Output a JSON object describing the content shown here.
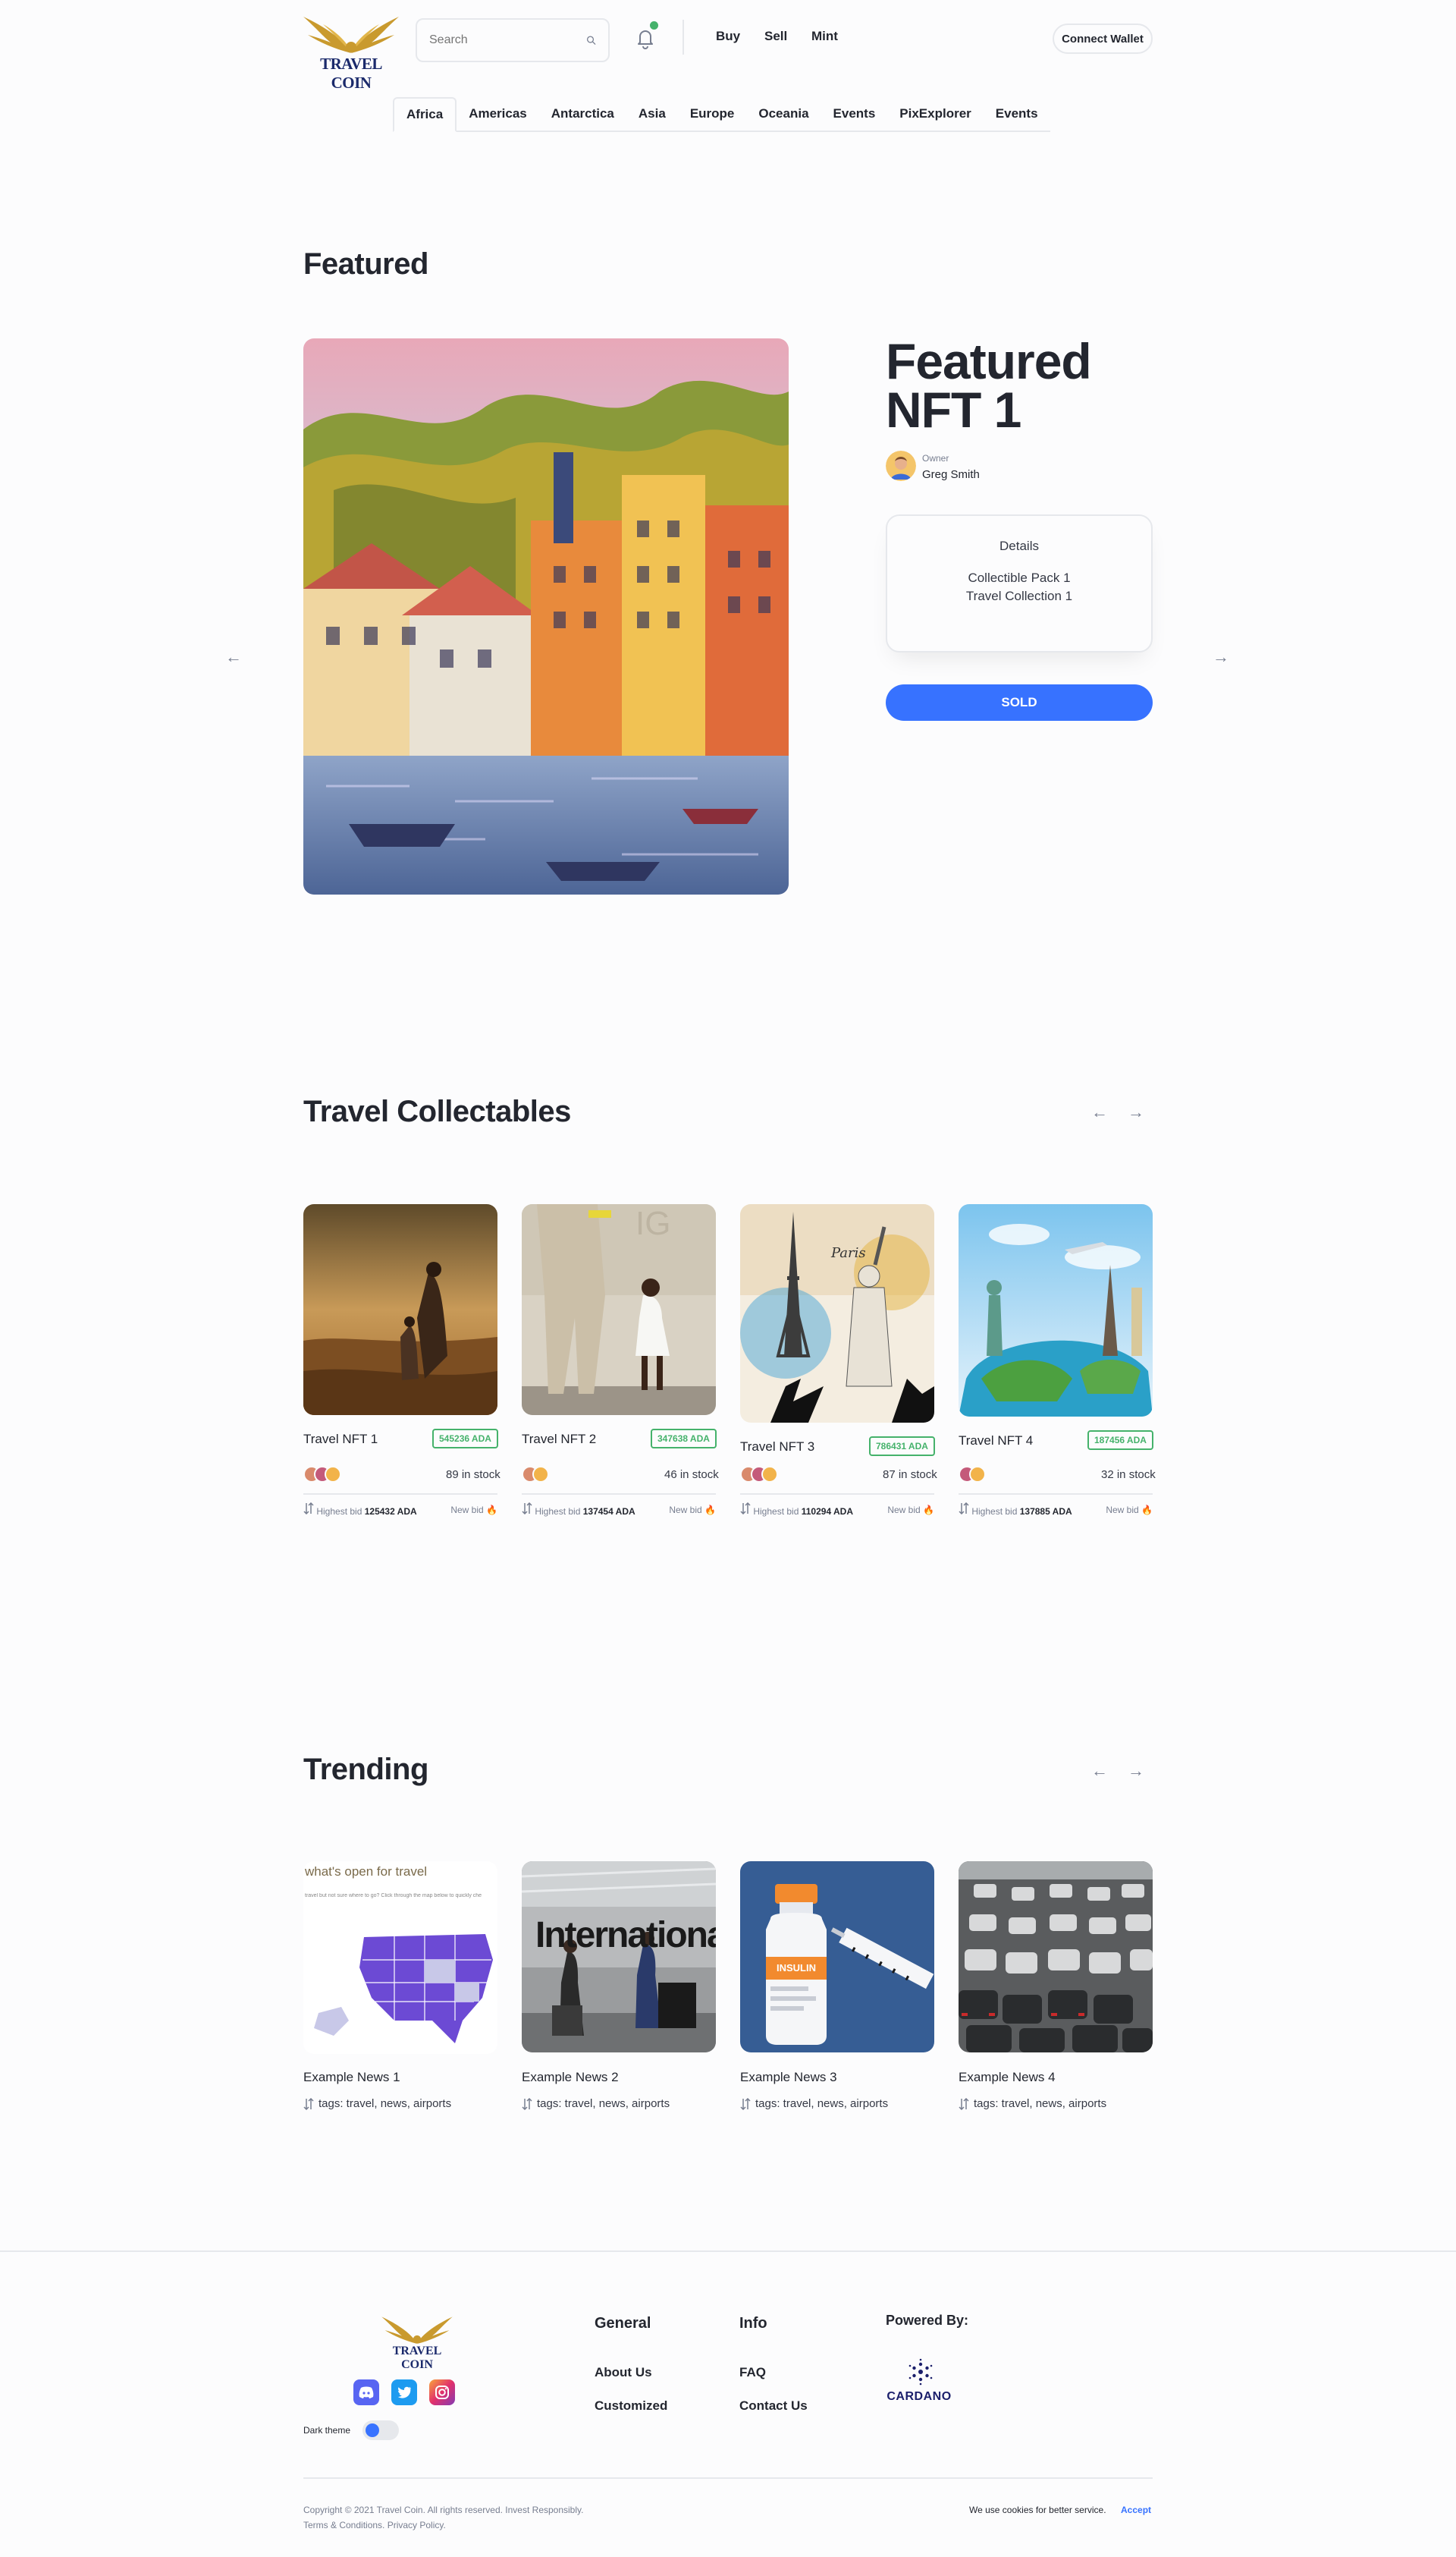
{
  "header": {
    "logo_text": "TRAVEL COIN",
    "search_placeholder": "Search",
    "nav": [
      "Buy",
      "Sell",
      "Mint"
    ],
    "connect_label": "Connect Wallet"
  },
  "regions": [
    "Africa",
    "Americas",
    "Antarctica",
    "Asia",
    "Europe",
    "Oceania",
    "Events",
    "PixExplorer",
    "Events"
  ],
  "active_region": "Africa",
  "featured": {
    "section_title": "Featured",
    "name": "Featured NFT 1",
    "owner_label": "Owner",
    "owner_name": "Greg Smith",
    "details_title": "Details",
    "details_lines": [
      "Collectible Pack 1",
      "Travel Collection 1"
    ],
    "status_label": "SOLD",
    "prev_arrow": "←",
    "next_arrow": "→"
  },
  "collectables": {
    "section_title": "Travel Collectables",
    "prev_arrow": "←",
    "next_arrow": "→",
    "items": [
      {
        "title": "Travel NFT 1",
        "price": "545236 ADA",
        "stock": "89 in stock",
        "bid_label": "Highest bid",
        "bid_value": "125432 ADA",
        "new_bid": "New bid"
      },
      {
        "title": "Travel NFT 2",
        "price": "347638 ADA",
        "stock": "46 in stock",
        "bid_label": "Highest bid",
        "bid_value": "137454 ADA",
        "new_bid": "New bid"
      },
      {
        "title": "Travel NFT 3",
        "price": "786431 ADA",
        "stock": "87 in stock",
        "bid_label": "Highest bid",
        "bid_value": "110294 ADA",
        "new_bid": "New bid"
      },
      {
        "title": "Travel NFT 4",
        "price": "187456 ADA",
        "stock": "32 in stock",
        "bid_label": "Highest bid",
        "bid_value": "137885 ADA",
        "new_bid": "New bid"
      }
    ]
  },
  "trending": {
    "section_title": "Trending",
    "prev_arrow": "←",
    "next_arrow": "→",
    "items": [
      {
        "title": "Example News 1",
        "tags": "tags: travel, news, airports",
        "img_caption": "what's open for travel",
        "img_sub": "travel but not sure where to go? Click through the map below to quickly che"
      },
      {
        "title": "Example News 2",
        "tags": "tags: travel, news, airports",
        "img_caption": "International Arr"
      },
      {
        "title": "Example News 3",
        "tags": "tags: travel, news, airports",
        "img_caption": "INSULIN"
      },
      {
        "title": "Example News 4",
        "tags": "tags: travel, news, airports"
      }
    ]
  },
  "footer": {
    "logo_text": "TRAVEL COIN",
    "dark_theme_label": "Dark theme",
    "columns": [
      {
        "title": "General",
        "links": [
          "About Us",
          "Customized"
        ]
      },
      {
        "title": "Info",
        "links": [
          "FAQ",
          "Contact Us"
        ]
      }
    ],
    "powered_by": "Powered By:",
    "cardano_text": "CARDANO",
    "copyright": "Copyright © 2021 Travel Coin. All rights reserved. Invest Responsibly.",
    "terms": "Terms & Conditions. Privacy Policy.",
    "cookies": "We use cookies for better service.",
    "accept": "Accept"
  },
  "colors": {
    "primary": "#3772ff",
    "price_green": "#45b26b",
    "text": "#23262f",
    "muted": "#777e90",
    "border": "#e6e8ec",
    "logo_navy": "#1b2a6b",
    "logo_gold": "#c99a2e"
  }
}
